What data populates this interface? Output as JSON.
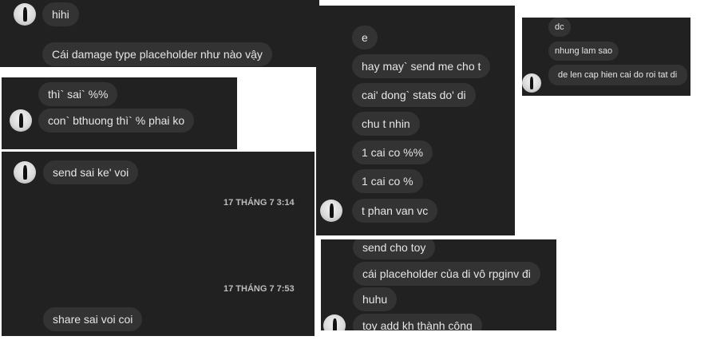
{
  "panel_a": {
    "messages": [
      "hihi",
      "Cái damage type placeholder như nào vậy"
    ]
  },
  "panel_b": {
    "messages": [
      "thì` sai` %%",
      "con` bthuong thì` % phai ko"
    ]
  },
  "panel_c": {
    "messages": [
      "send sai ke' voi",
      "share sai voi coi"
    ],
    "timestamps": [
      "17 THÁNG 7 3:14",
      "17 THÁNG 7 7:53"
    ]
  },
  "panel_d": {
    "messages": [
      "e",
      "hay may` send me cho t",
      "cai' dong` stats do' di",
      "chu t nhin",
      "1 cai co %%",
      "1 cai co %",
      "t phan van vc"
    ]
  },
  "panel_e": {
    "messages": [
      "dc",
      "nhung lam sao",
      "de len cap hien cai do roi tat di"
    ]
  },
  "panel_f": {
    "messages": [
      "send cho toy",
      "cái placeholder của di vô rpginv đi",
      "huhu",
      "toy add kh thành công"
    ]
  }
}
